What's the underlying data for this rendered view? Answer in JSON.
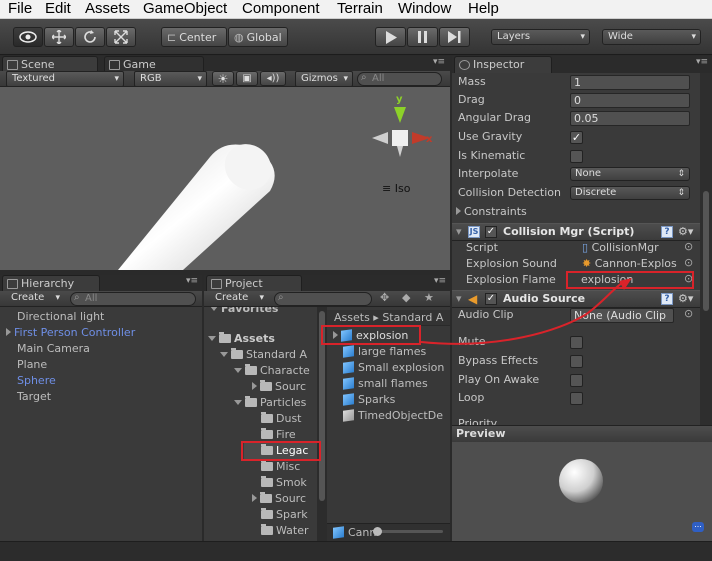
{
  "menu": [
    "File",
    "Edit",
    "Assets",
    "GameObject",
    "Component",
    "Terrain",
    "Window",
    "Help"
  ],
  "toolbar": {
    "pivot": "Center",
    "space": "Global",
    "layers": "Layers",
    "layout": "Wide"
  },
  "scene": {
    "tab_scene": "Scene",
    "tab_game": "Game",
    "render_mode": "Textured",
    "channel": "RGB",
    "gizmos": "Gizmos",
    "search_placeholder": "All",
    "gizmo_label": "Iso",
    "axis_y": "y",
    "axis_x": "x"
  },
  "hierarchy": {
    "title": "Hierarchy",
    "create": "Create",
    "search_placeholder": "All",
    "items": [
      {
        "label": "Directional light",
        "color": "#c8c8c8"
      },
      {
        "label": "First Person Controller",
        "color": "#6f8fe6"
      },
      {
        "label": "Main Camera",
        "color": "#c8c8c8"
      },
      {
        "label": "Plane",
        "color": "#c8c8c8"
      },
      {
        "label": "Sphere",
        "color": "#6f8fe6"
      },
      {
        "label": "Target",
        "color": "#c8c8c8"
      }
    ]
  },
  "project": {
    "title": "Project",
    "create": "Create",
    "tree": [
      "Favorites",
      "Assets",
      "Standard A",
      "Characte",
      "Sourc",
      "Particles",
      "Dust",
      "Fire",
      "Legac",
      "Misc",
      "Smok",
      "Sourc",
      "Spark",
      "Water"
    ],
    "breadcrumb": [
      "Assets",
      "Standard A"
    ],
    "files": [
      "explosion",
      "large flames",
      "Small explosion",
      "small flames",
      "Sparks",
      "TimedObjectDe"
    ],
    "bottom_item": "Cann"
  },
  "inspector": {
    "title": "Inspector",
    "rigidbody": [
      {
        "label": "Mass",
        "value": "1"
      },
      {
        "label": "Drag",
        "value": "0"
      },
      {
        "label": "Angular Drag",
        "value": "0.05"
      }
    ],
    "use_gravity": "Use Gravity",
    "is_kinematic": "Is Kinematic",
    "interpolate": {
      "label": "Interpolate",
      "value": "None"
    },
    "collision_detection": {
      "label": "Collision Detection",
      "value": "Discrete"
    },
    "constraints": "Constraints",
    "script_component": {
      "title": "Collision Mgr (Script)",
      "fields": [
        {
          "label": "Script",
          "value": "CollisionMgr"
        },
        {
          "label": "Explosion Sound",
          "value": "Cannon-Explos"
        },
        {
          "label": "Explosion Flame",
          "value": "explosion"
        }
      ]
    },
    "audio_component": {
      "title": "Audio Source",
      "audio_clip": {
        "label": "Audio Clip",
        "value": "None (Audio Clip"
      },
      "toggles": [
        "Mute",
        "Bypass Effects",
        "Play On Awake",
        "Loop"
      ],
      "priority": "Priority"
    },
    "preview_title": "Preview"
  },
  "colors": {
    "annotation": "#d9232a",
    "selection": "#3d6ec7"
  }
}
